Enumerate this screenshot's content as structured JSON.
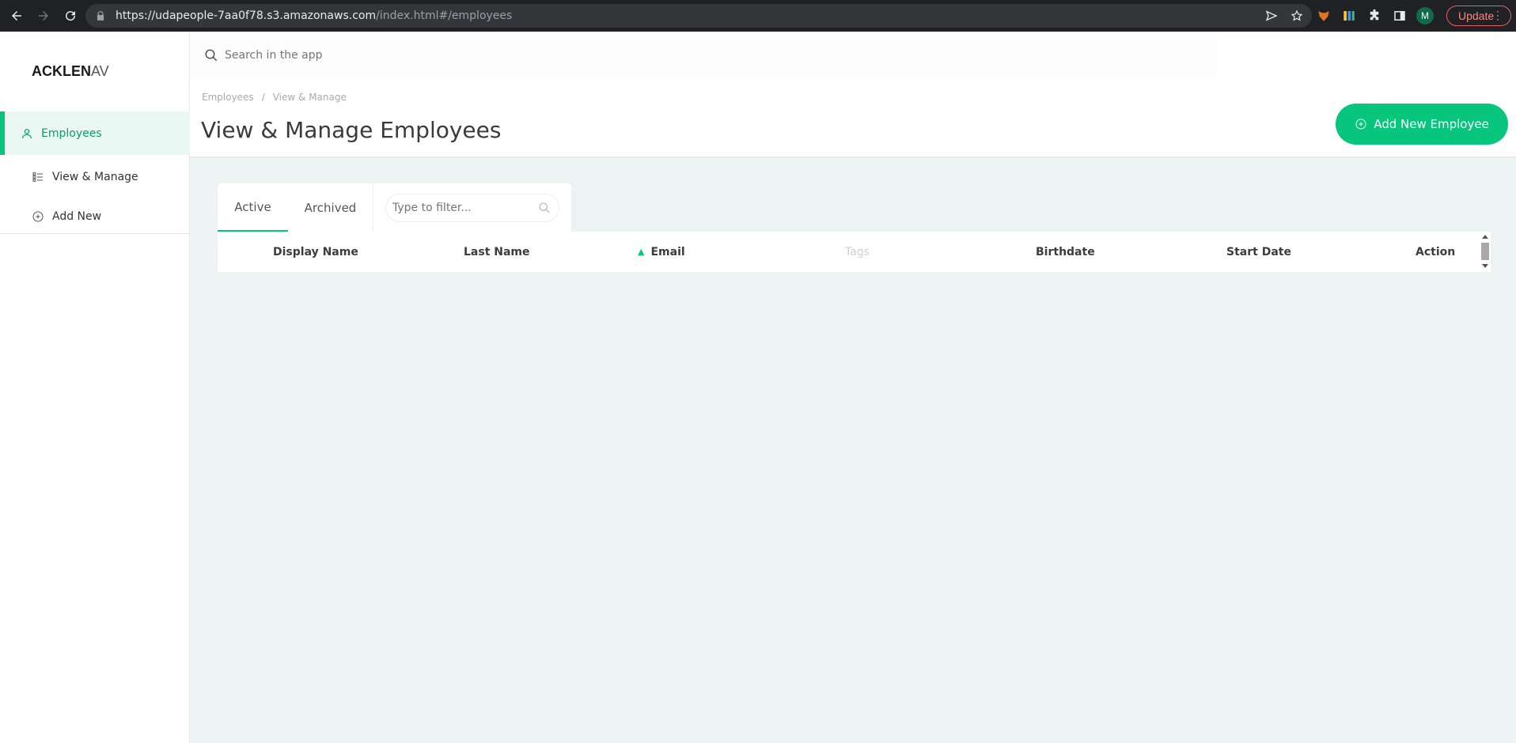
{
  "browser": {
    "url_main": "https://udapeople-7aa0f78.s3.amazonaws.com",
    "url_path": "/index.html#/employees",
    "profile_initial": "M",
    "update_label": "Update"
  },
  "sidebar": {
    "logo_bold": "ACKLEN",
    "logo_light": "AV",
    "section": {
      "label": "Employees",
      "icon": "user-icon"
    },
    "items": [
      {
        "label": "View & Manage",
        "icon": "list-icon"
      },
      {
        "label": "Add New",
        "icon": "plus-circle-icon"
      }
    ]
  },
  "header": {
    "search_placeholder": "Search in the app",
    "breadcrumb": [
      "Employees",
      "/",
      "View & Manage"
    ],
    "title": "View & Manage Employees",
    "add_button_label": "Add New Employee"
  },
  "tabs": {
    "items": [
      "Active",
      "Archived"
    ],
    "active": "Active",
    "filter_placeholder": "Type to filter..."
  },
  "table": {
    "columns": [
      "Display Name",
      "Last Name",
      "Email",
      "Tags",
      "Birthdate",
      "Start Date",
      "Action"
    ],
    "sorted_column": "Email",
    "sort_direction": "ascending",
    "rows": []
  },
  "colors": {
    "accent": "#07c57d",
    "content_bg": "#edf2f2",
    "browser_bar": "#202124"
  }
}
